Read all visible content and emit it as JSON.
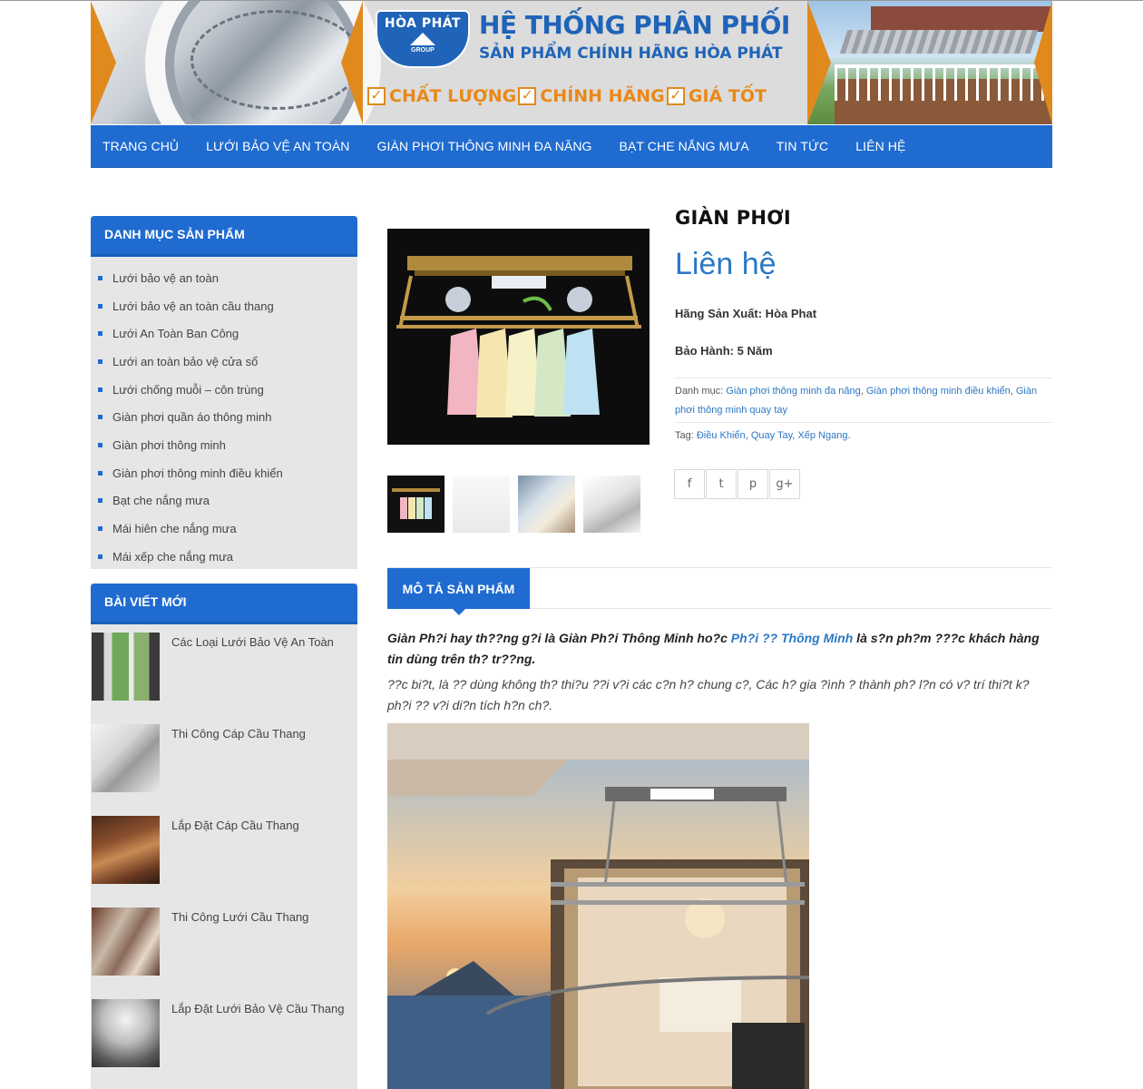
{
  "banner": {
    "logo_top": "HÒA PHÁT",
    "logo_bottom": "GROUP",
    "title": "HỆ THỐNG PHÂN PHỐI",
    "subtitle": "SẢN PHẨM CHÍNH HÃNG HÒA PHÁT",
    "badges": [
      "CHẤT LƯỢNG",
      "CHÍNH HÃNG",
      "GIÁ TỐT"
    ],
    "accent_color": "#e8891a",
    "brand_color": "#1f64b8"
  },
  "nav": {
    "items": [
      "TRANG CHỦ",
      "LƯỚI BẢO VỆ AN TOÀN",
      "GIÀN PHƠI THÔNG MINH ĐA NĂNG",
      "BẠT CHE NẮNG MƯA",
      "TIN TỨC",
      "LIÊN HỆ"
    ]
  },
  "sidebar": {
    "categories_title": "DANH MỤC SẢN PHẨM",
    "categories": [
      "Lưới bảo vệ an toàn",
      "Lưới bảo vệ an toàn cầu thang",
      "Lưới An Toàn Ban Công",
      "Lưới an toàn bảo vệ cửa sổ",
      "Lưới chống muỗi – côn trùng",
      "Giàn phơi quần áo thông minh",
      "Giàn phơi thông minh",
      "Giàn phơi thông minh điều khiển",
      "Bạt che nắng mưa",
      "Mái hiên che nắng mưa",
      "Mái xếp che nắng mưa"
    ],
    "posts_title": "BÀI VIẾT MỚI",
    "posts": [
      "Các Loại Lưới Bảo Vệ An Toàn",
      "Thi Công Cáp Cầu Thang",
      "Lắp Đặt Cáp Cầu Thang",
      "Thi Công Lưới Cầu Thang",
      "Lắp Đặt Lưới Bảo Vệ Cầu Thang"
    ]
  },
  "product": {
    "title": "GIÀN PHƠI",
    "price": "Liên hệ",
    "manufacturer": "Hãng Sản Xuất: Hòa Phat",
    "warranty": "Bảo Hành: 5 Năm",
    "category_label": "Danh mục:",
    "categories": [
      "Giàn phơi thông minh đa năng",
      "Giàn phơi thông minh điều khiển",
      "Giàn phơi thông minh quay tay"
    ],
    "tag_label": "Tag:",
    "tags": [
      "Điều Khiển",
      "Quay Tay",
      "Xếp Ngang"
    ],
    "social_icons": [
      "facebook-icon",
      "twitter-icon",
      "pinterest-icon",
      "google-plus-icon"
    ],
    "social_glyphs": [
      "f",
      "t",
      "p",
      "g+"
    ]
  },
  "tabs": {
    "description": "MÔ TẢ SẢN PHẨM"
  },
  "description": {
    "p1_before": "Giàn Ph?i hay th??ng g?i là Giàn Ph?i Thông Minh ho?c ",
    "p1_link": "Ph?i ?? Thông Minh",
    "p1_after": " là s?n ph?m ???c khách hàng tin dùng trên th? tr??ng.",
    "p2": "??c bi?t, là ?? dùng không th? thi?u ??i v?i các c?n h? chung c?, Các h? gia ?ình ? thành ph? l?n có v? trí thi?t k? ph?i ?? v?i di?n tích h?n ch?."
  }
}
